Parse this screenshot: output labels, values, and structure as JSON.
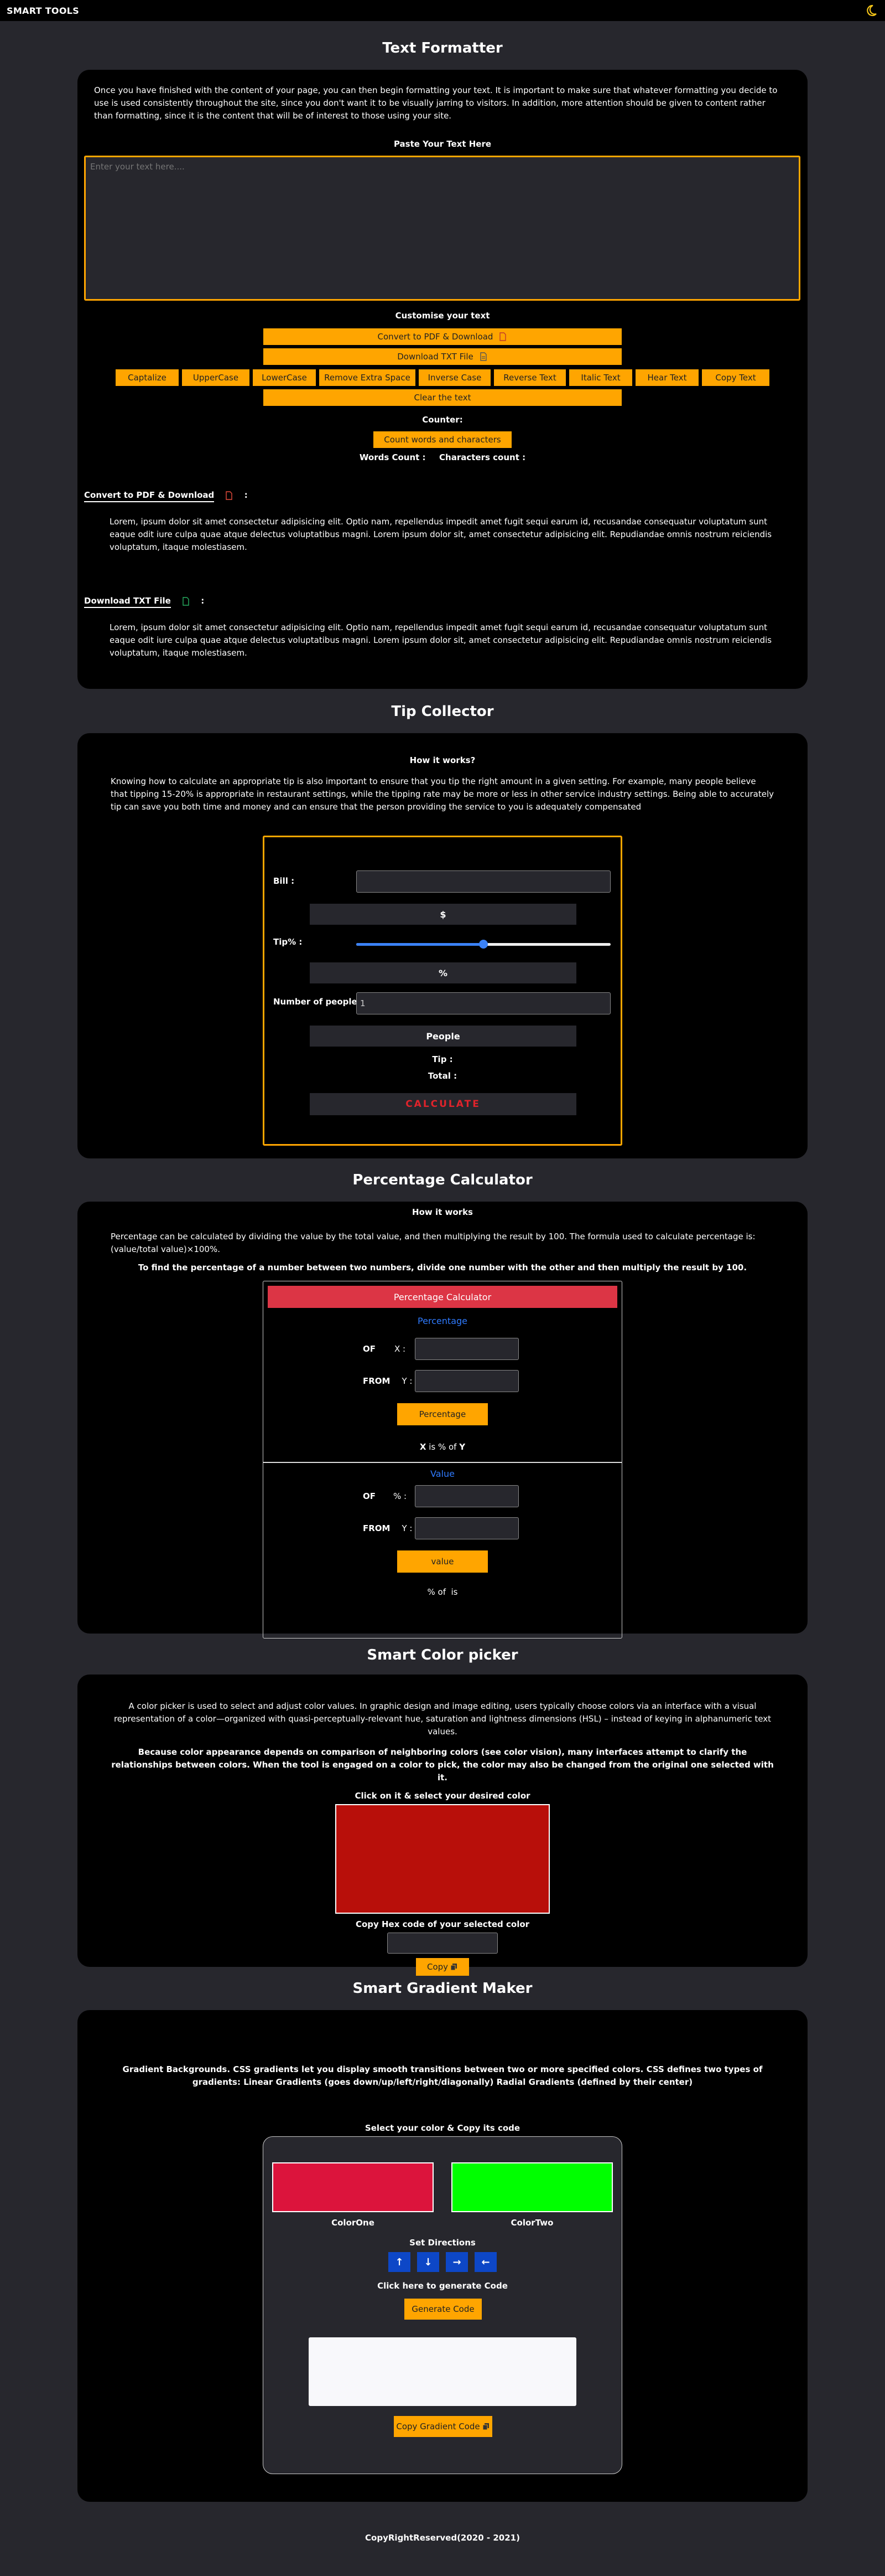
{
  "header": {
    "brand": "SMART TOOLS",
    "theme_icon": "moon-icon",
    "accent": "#f5c518"
  },
  "text_formatter": {
    "title": "Text Formatter",
    "intro": "Once you have finished with the content of your page, you can then begin formatting your text. It is important to make sure that whatever formatting you decide to use is used consistently throughout the site, since you don't want it to be visually jarring to visitors. In addition, more attention should be given to content rather than formatting, since it is the content that will be of interest to those using your site.",
    "paste_label": "Paste Your Text Here",
    "textarea_placeholder": "Enter your text here....",
    "customise_label": "Customise your text",
    "pdf_btn": "Convert to PDF & Download",
    "txt_btn": "Download TXT File",
    "actions": [
      "Captalize",
      "UpperCase",
      "LowerCase",
      "Remove Extra Space",
      "Inverse Case",
      "Reverse Text",
      "Italic Text",
      "Hear Text",
      "Copy Text"
    ],
    "clear_btn": "Clear the text",
    "counter_label": "Counter:",
    "count_btn": "Count words and characters",
    "words_label": "Words Count :",
    "chars_label": "Characters count :",
    "pdf_heading": "Convert to PDF & Download",
    "pdf_desc": "Lorem, ipsum dolor sit amet consectetur adipisicing elit. Optio nam, repellendus impedit amet fugit sequi earum id, recusandae consequatur voluptatum sunt eaque odit iure culpa quae atque delectus voluptatibus magni. Lorem ipsum dolor sit, amet consectetur adipisicing elit. Repudiandae omnis nostrum reiciendis voluptatum, itaque molestiasem.",
    "txt_heading": "Download TXT File",
    "txt_desc": "Lorem, ipsum dolor sit amet consectetur adipisicing elit. Optio nam, repellendus impedit amet fugit sequi earum id, recusandae consequatur voluptatum sunt eaque odit iure culpa quae atque delectus voluptatibus magni. Lorem ipsum dolor sit, amet consectetur adipisicing elit. Repudiandae omnis nostrum reiciendis voluptatum, itaque molestiasem.",
    "colon": ":"
  },
  "tip_collector": {
    "title": "Tip Collector",
    "how_title": "How it works?",
    "how_text": "Knowing how to calculate an appropriate tip is also important to ensure that you tip the right amount in a given setting. For example, many people believe that tipping 15-20% is appropriate in restaurant settings, while the tipping rate may be more or less in other service industry settings. Being able to accurately tip can save you both time and money and can ensure that the person providing the service to you is adequately compensated",
    "bill_label": "Bill :",
    "dollar": "$",
    "tip_label": "Tip% :",
    "tip_percent_value": 0.5,
    "percent": "%",
    "people_label": "Number of people :",
    "people_value": "1",
    "people_unit": "People",
    "tip_result": "Tip :",
    "total_result": "Total :",
    "calc_btn": "CALCULATE",
    "calc_color": "#e0232b"
  },
  "percentage_calculator": {
    "title": "Percentage Calculator",
    "how_title": "How it works",
    "how_text": "Percentage can be calculated by dividing the value by the total value, and then multiplying the result by 100. The formula used to calculate percentage is: (value/total value)×100%.",
    "how_bold": "To find the percentage of a number between two numbers, divide one number with the other and then multiply the result by 100.",
    "header_bar": "Percentage Calculator",
    "header_color": "#dc3545",
    "link_color": "#2f7bff",
    "percentage": {
      "heading": "Percentage",
      "of_label": "OF",
      "of_var": "X :",
      "from_label": "FROM",
      "from_var": "Y :",
      "btn": "Percentage",
      "result_x": "X",
      "result_mid": "is % of",
      "result_y": "Y"
    },
    "value": {
      "heading": "Value",
      "of_label": "OF",
      "of_var": "% :",
      "from_label": "FROM",
      "from_var": "Y :",
      "btn": "value",
      "result": "% of  is"
    }
  },
  "color_picker": {
    "title": "Smart Color picker",
    "text1": "A color picker is used to select and adjust color values. In graphic design and image editing, users typically choose colors via an interface with a visual representation of a color—organized with quasi-perceptually-relevant hue, saturation and lightness dimensions (HSL) – instead of keying in alphanumeric text values.",
    "text2": "Because color appearance depends on comparison of neighboring colors (see color vision), many interfaces attempt to clarify the relationships between colors. When the tool is engaged on a color to pick, the color may also be changed from the original one selected with it.",
    "click_label": "Click on it & select your desired color",
    "swatch": "#b80f0a",
    "copy_label": "Copy Hex code of your selected color",
    "copy_btn": "Copy"
  },
  "gradient_maker": {
    "title": "Smart Gradient Maker",
    "text": "Gradient Backgrounds. CSS gradients let you display smooth transitions between two or more specified colors. CSS defines two types of gradients: Linear Gradients (goes down/up/left/right/diagonally) Radial Gradients (defined by their center)",
    "select_label": "Select your color & Copy its code",
    "color_one": "#dc143c",
    "color_one_label": "ColorOne",
    "color_two": "#00ff00",
    "color_two_label": "ColorTwo",
    "directions_label": "Set Directions",
    "direction_color": "#0d47c7",
    "directions": [
      "↑",
      "↓",
      "→",
      "←"
    ],
    "generate_label": "Click here to generate Code",
    "generate_btn": "Generate Code",
    "copy_btn": "Copy Gradient Code"
  },
  "footer": {
    "text": "CopyRightReserved(2020 - 2021)"
  }
}
